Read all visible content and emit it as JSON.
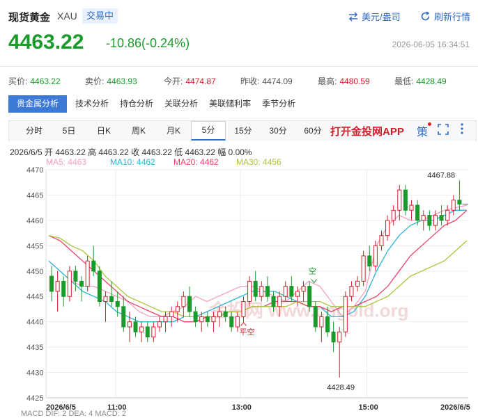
{
  "header": {
    "title": "现货黄金",
    "symbol": "XAU",
    "status_badge": "交易中",
    "currency_button": "美元/盎司",
    "refresh_button": "刷新行情"
  },
  "quote": {
    "price": "4463.22",
    "change": "-10.86(-0.24%)",
    "timestamp": "2026-06-05 16:34:51"
  },
  "stats": [
    {
      "label": "买价:",
      "value": "4463.22",
      "color": "#1b9a2c"
    },
    {
      "label": "卖价:",
      "value": "4463.93",
      "color": "#1b9a2c"
    },
    {
      "label": "今开:",
      "value": "4474.87",
      "color": "#d21f2a"
    },
    {
      "label": "昨收:",
      "value": "4474.09",
      "color": "#333333"
    },
    {
      "label": "最高:",
      "value": "4480.59",
      "color": "#d21f2a"
    },
    {
      "label": "最低:",
      "value": "4428.49",
      "color": "#1b9a2c"
    }
  ],
  "analysis_tabs": [
    "贵金属分析",
    "技术分析",
    "持仓分析",
    "关联分析",
    "美联储利率",
    "季节分析"
  ],
  "period_tabs": [
    "分时",
    "5日",
    "日K",
    "周K",
    "月K",
    "5分",
    "15分",
    "30分",
    "60分"
  ],
  "active_period": "5分",
  "app_promo": "打开金投网APP",
  "toolbar_icons": [
    "strategy-icon",
    "fullscreen-icon",
    "more-icon"
  ],
  "strategy_label": "策",
  "bar_info": "2026/6/5  开 4463.22  高 4463.22  收 4463.22  低 4463.22  幅 0.00%",
  "ma_legend": [
    {
      "label": "MA5: 4463",
      "color": "#f5a0c0"
    },
    {
      "label": "MA10: 4462",
      "color": "#29b6d8"
    },
    {
      "label": "MA20: 4462",
      "color": "#e8436a"
    },
    {
      "label": "MA30: 4456",
      "color": "#a8c63a"
    }
  ],
  "macd_label": "MACD  DIF: 2  DEA: 4  MACD: 2",
  "chart_data": {
    "type": "candlestick",
    "ylim": [
      4425,
      4470
    ],
    "y_ticks": [
      4470,
      4465,
      4460,
      4455,
      4450,
      4445,
      4440,
      4435,
      4430,
      4425
    ],
    "x_labels": [
      "2026/6/5",
      "11:00",
      "13:00",
      "15:00",
      "2026/6/5"
    ],
    "annotations": {
      "high": "4467.88",
      "low": "4428.49",
      "short": "空",
      "close_short": "平空",
      "watermark": "金投网 www.cngold.org"
    },
    "up_color": "#d21f2a",
    "down_color": "#1b9a2c",
    "candles": [
      [
        4449,
        4451,
        4444,
        4446
      ],
      [
        4446,
        4450,
        4442,
        4448
      ],
      [
        4448,
        4449,
        4443,
        4445
      ],
      [
        4445,
        4451,
        4444,
        4450
      ],
      [
        4450,
        4451,
        4446,
        4448
      ],
      [
        4448,
        4449,
        4444,
        4447
      ],
      [
        4447,
        4453,
        4446,
        4452
      ],
      [
        4452,
        4455,
        4449,
        4450
      ],
      [
        4450,
        4451,
        4443,
        4444
      ],
      [
        4444,
        4446,
        4440,
        4445
      ],
      [
        4445,
        4448,
        4443,
        4444
      ],
      [
        4444,
        4446,
        4441,
        4443
      ],
      [
        4443,
        4445,
        4438,
        4439
      ],
      [
        4439,
        4442,
        4436,
        4440
      ],
      [
        4440,
        4441,
        4437,
        4438
      ],
      [
        4438,
        4440,
        4436,
        4439
      ],
      [
        4439,
        4440,
        4436,
        4437
      ],
      [
        4437,
        4440,
        4436,
        4439
      ],
      [
        4439,
        4441,
        4438,
        4440
      ],
      [
        4440,
        4442,
        4438,
        4441
      ],
      [
        4441,
        4443,
        4439,
        4442
      ],
      [
        4442,
        4444,
        4440,
        4443
      ],
      [
        4443,
        4446,
        4441,
        4445
      ],
      [
        4445,
        4447,
        4441,
        4442
      ],
      [
        4442,
        4443,
        4439,
        4440
      ],
      [
        4440,
        4442,
        4438,
        4441
      ],
      [
        4441,
        4442,
        4439,
        4440
      ],
      [
        4440,
        4442,
        4438,
        4441
      ],
      [
        4441,
        4443,
        4439,
        4442
      ],
      [
        4442,
        4443,
        4440,
        4441
      ],
      [
        4441,
        4442,
        4438,
        4439
      ],
      [
        4439,
        4442,
        4438,
        4441
      ],
      [
        4441,
        4445,
        4440,
        4444
      ],
      [
        4444,
        4449,
        4443,
        4448
      ],
      [
        4448,
        4450,
        4444,
        4445
      ],
      [
        4445,
        4448,
        4444,
        4447
      ],
      [
        4447,
        4449,
        4444,
        4445
      ],
      [
        4445,
        4446,
        4442,
        4443
      ],
      [
        4443,
        4446,
        4441,
        4445
      ],
      [
        4445,
        4448,
        4444,
        4447
      ],
      [
        4447,
        4449,
        4444,
        4445
      ],
      [
        4445,
        4447,
        4443,
        4446
      ],
      [
        4446,
        4448,
        4444,
        4447
      ],
      [
        4447,
        4448,
        4442,
        4443
      ],
      [
        4443,
        4444,
        4438,
        4439
      ],
      [
        4439,
        4442,
        4436,
        4441
      ],
      [
        4441,
        4443,
        4437,
        4438
      ],
      [
        4438,
        4440,
        4434,
        4436
      ],
      [
        4436,
        4439,
        4429,
        4438
      ],
      [
        4438,
        4446,
        4437,
        4445
      ],
      [
        4445,
        4448,
        4444,
        4447
      ],
      [
        4447,
        4449,
        4446,
        4448
      ],
      [
        4448,
        4454,
        4447,
        4453
      ],
      [
        4453,
        4455,
        4450,
        4451
      ],
      [
        4451,
        4456,
        4450,
        4455
      ],
      [
        4455,
        4458,
        4454,
        4457
      ],
      [
        4457,
        4461,
        4456,
        4460
      ],
      [
        4460,
        4463,
        4459,
        4462
      ],
      [
        4462,
        4467,
        4460,
        4466
      ],
      [
        4466,
        4467,
        4461,
        4462
      ],
      [
        4462,
        4464,
        4460,
        4463
      ],
      [
        4463,
        4464,
        4459,
        4460
      ],
      [
        4460,
        4462,
        4458,
        4461
      ],
      [
        4461,
        4462,
        4458,
        4459
      ],
      [
        4459,
        4462,
        4458,
        4461
      ],
      [
        4461,
        4463,
        4459,
        4460
      ],
      [
        4460,
        4463,
        4459,
        4462
      ],
      [
        4462,
        4465,
        4461,
        4464
      ],
      [
        4464,
        4467.88,
        4462,
        4463.22
      ]
    ],
    "ma_series": [
      {
        "name": "MA5",
        "color": "#f5a0c0",
        "values": [
          4452,
          4450,
          4448,
          4447,
          4447,
          4446,
          4445,
          4444,
          4442,
          4441,
          4441,
          4442,
          4443,
          4445,
          4444,
          4445,
          4446,
          4447,
          4447,
          4446,
          4445,
          4444,
          4446,
          4448,
          4447,
          4444,
          4441,
          4443,
          4446,
          4455,
          4459,
          4461,
          4460,
          4460,
          4461,
          4462,
          4462.5,
          4463
        ]
      },
      {
        "name": "MA10",
        "color": "#29b6d8",
        "values": [
          4452,
          4450,
          4448,
          4446,
          4445,
          4444,
          4442,
          4441,
          4440,
          4440,
          4440,
          4440,
          4441,
          4441,
          4442,
          4443,
          4444,
          4445,
          4446,
          4446,
          4446,
          4445,
          4444,
          4443,
          4443,
          4441,
          4441,
          4442,
          4445,
          4450,
          4454,
          4457,
          4459,
          4460,
          4460,
          4461,
          4462,
          4462
        ]
      },
      {
        "name": "MA20",
        "color": "#e8436a",
        "values": [
          4457,
          4456,
          4454,
          4452,
          4450,
          4448,
          4446,
          4444,
          4443,
          4442,
          4441,
          4441,
          4440,
          4440,
          4441,
          4441,
          4442,
          4442,
          4443,
          4443,
          4444,
          4444,
          4444,
          4443,
          4443,
          4442,
          4443,
          4443,
          4444,
          4445,
          4447,
          4450,
          4453,
          4455,
          4457,
          4459,
          4460,
          4462
        ]
      },
      {
        "name": "MA30",
        "color": "#a8c63a",
        "values": [
          4457,
          4456.5,
          4455,
          4454,
          4452,
          4449,
          4447,
          4445,
          4444,
          4443,
          4442,
          4442,
          4441,
          4441,
          4441,
          4441,
          4442,
          4442,
          4443,
          4443,
          4443,
          4443,
          4444,
          4444,
          4444,
          4443,
          4443,
          4443,
          4443,
          4444,
          4445,
          4447,
          4449,
          4450,
          4451,
          4452,
          4454,
          4456
        ]
      }
    ]
  }
}
